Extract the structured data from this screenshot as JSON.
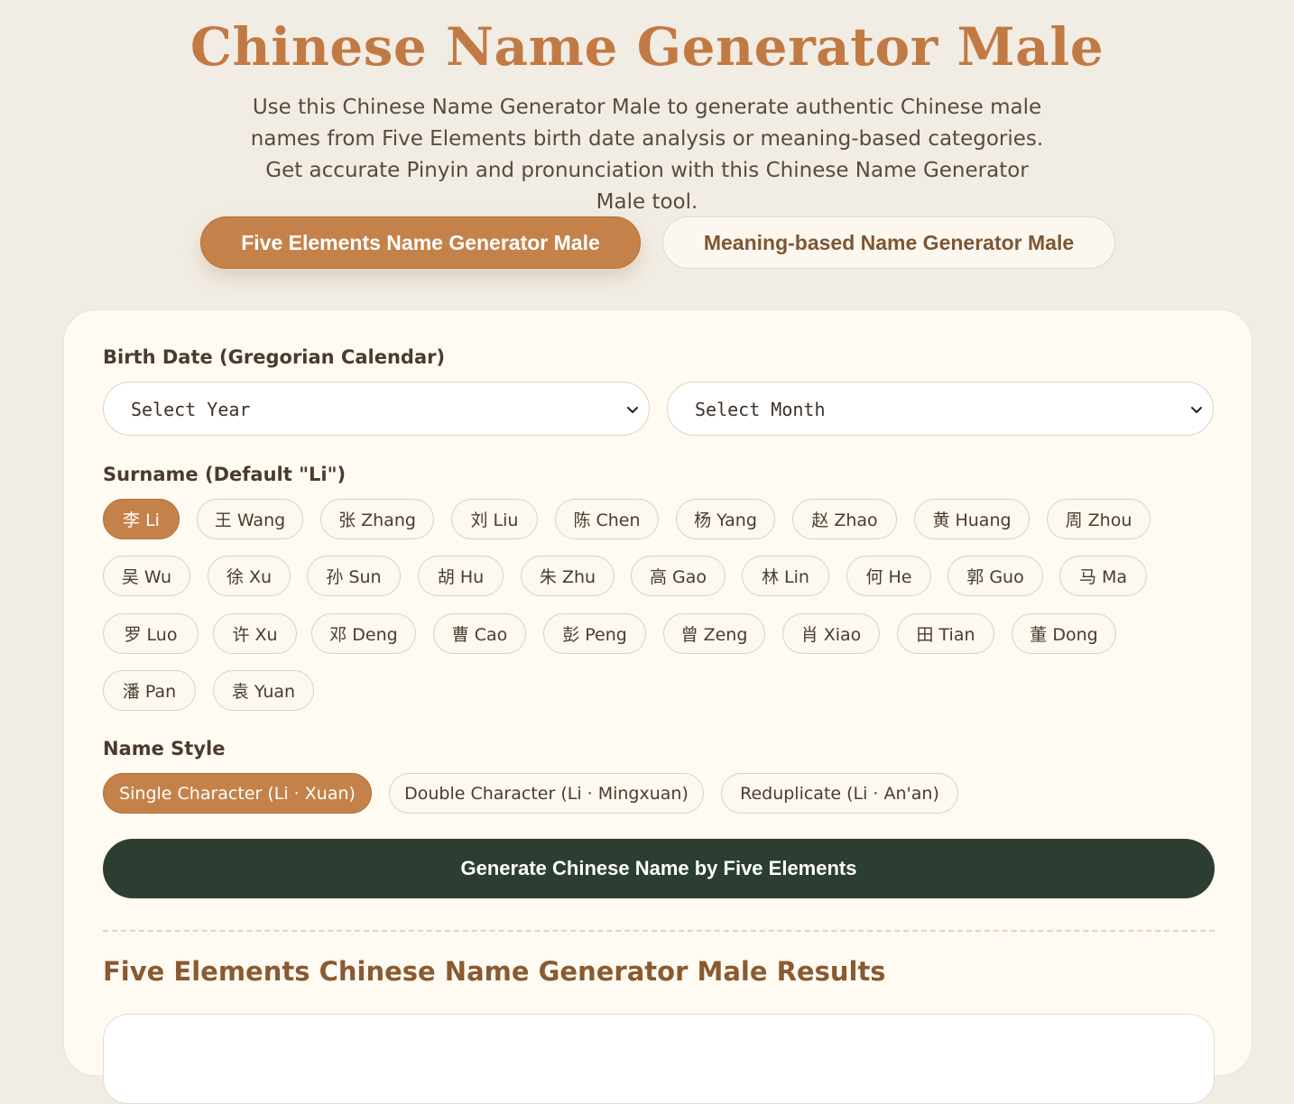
{
  "header": {
    "title": "Chinese Name Generator Male",
    "description": "Use this Chinese Name Generator Male to generate authentic Chinese male names from Five Elements birth date analysis or meaning-based categories. Get accurate Pinyin and pronunciation with this Chinese Name Generator Male tool."
  },
  "tabs": [
    {
      "label": "Five Elements Name Generator Male",
      "active": true
    },
    {
      "label": "Meaning-based Name Generator Male",
      "active": false
    }
  ],
  "form": {
    "birth_date_label": "Birth Date (Gregorian Calendar)",
    "year_select": "Select Year",
    "month_select": "Select Month",
    "surname_label": "Surname (Default \"Li\")",
    "surnames": [
      "李 Li",
      "王 Wang",
      "张 Zhang",
      "刘 Liu",
      "陈 Chen",
      "杨 Yang",
      "赵 Zhao",
      "黄 Huang",
      "周 Zhou",
      "吴 Wu",
      "徐 Xu",
      "孙 Sun",
      "胡 Hu",
      "朱 Zhu",
      "高 Gao",
      "林 Lin",
      "何 He",
      "郭 Guo",
      "马 Ma",
      "罗 Luo",
      "许 Xu",
      "邓 Deng",
      "曹 Cao",
      "彭 Peng",
      "曾 Zeng",
      "肖 Xiao",
      "田 Tian",
      "董 Dong",
      "潘 Pan",
      "袁 Yuan"
    ],
    "selected_surname": "李 Li",
    "name_style_label": "Name Style",
    "name_styles": [
      "Single Character (Li · Xuan)",
      "Double Character (Li · Mingxuan)",
      "Reduplicate (Li · An'an)"
    ],
    "selected_style": "Single Character (Li · Xuan)",
    "generate_label": "Generate Chinese Name by Five Elements"
  },
  "results": {
    "title": "Five Elements Chinese Name Generator Male Results"
  },
  "colors": {
    "accent": "#c4824a",
    "title": "#c27a44",
    "dark_button": "#2c3e31",
    "background": "#f2ede4",
    "card": "#fffbf3"
  }
}
